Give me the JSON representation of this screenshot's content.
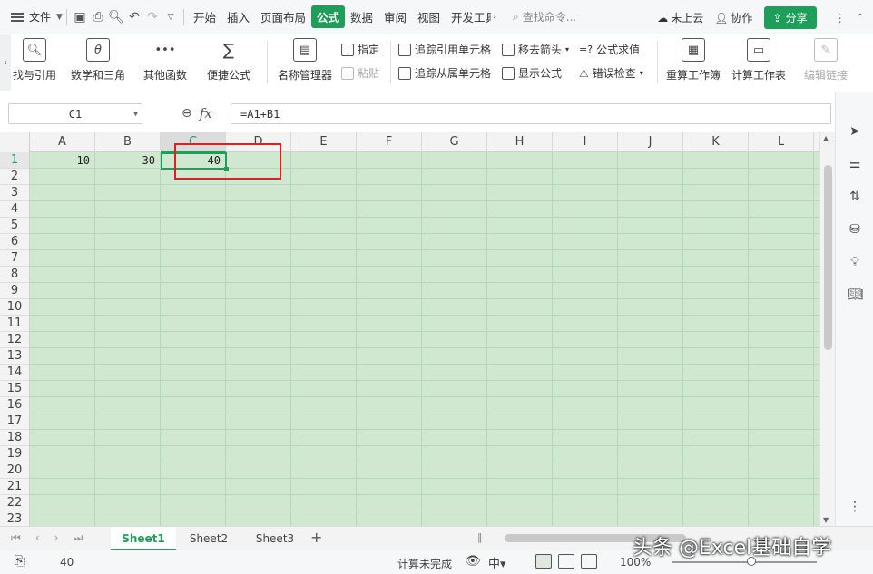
{
  "menubar": {
    "file_label": "文件",
    "tabs": [
      "开始",
      "插入",
      "页面布局",
      "公式",
      "数据",
      "审阅",
      "视图",
      "开发工具"
    ],
    "active_tab": "公式",
    "search_placeholder": "查找命令...",
    "cloud_status": "未上云",
    "collab_label": "协作",
    "share_label": "分享"
  },
  "ribbon": {
    "big_buttons": {
      "lookup": "找与引用",
      "math": "数学和三角",
      "other": "其他函数",
      "quick": "便捷公式",
      "name_mgr": "名称管理器",
      "recalc_wb": "重算工作簿",
      "calc_ws": "计算工作表",
      "edit_links": "编辑链接"
    },
    "small": {
      "specify": "指定",
      "paste": "粘贴",
      "trace_precedents": "追踪引用单元格",
      "trace_dependents": "追踪从属单元格",
      "remove_arrows": "移去箭头",
      "show_formulas": "显示公式",
      "eval_formula": "公式求值",
      "error_check": "错误检查"
    }
  },
  "formula_bar": {
    "name_box": "C1",
    "formula": "=A1+B1"
  },
  "grid": {
    "columns": [
      "A",
      "B",
      "C",
      "D",
      "E",
      "F",
      "G",
      "H",
      "I",
      "J",
      "K",
      "L"
    ],
    "rows": [
      "1",
      "2",
      "3",
      "4",
      "5",
      "6",
      "7",
      "8",
      "9",
      "10",
      "11",
      "12",
      "13",
      "14",
      "15",
      "16",
      "17",
      "18",
      "19",
      "20",
      "21",
      "22",
      "23"
    ],
    "cells": {
      "A1": "10",
      "B1": "30",
      "C1": "40"
    },
    "selected_cell": "C1"
  },
  "sheets": {
    "tabs": [
      "Sheet1",
      "Sheet2",
      "Sheet3"
    ],
    "active": "Sheet1"
  },
  "statusbar": {
    "value": "40",
    "calc_status": "计算未完成",
    "zoom": "100%"
  },
  "watermark": "头条 @Excel基础自学",
  "colors": {
    "accent": "#1e9e5a",
    "grid_bg": "#cfe8cf",
    "highlight_box": "#e02020"
  }
}
